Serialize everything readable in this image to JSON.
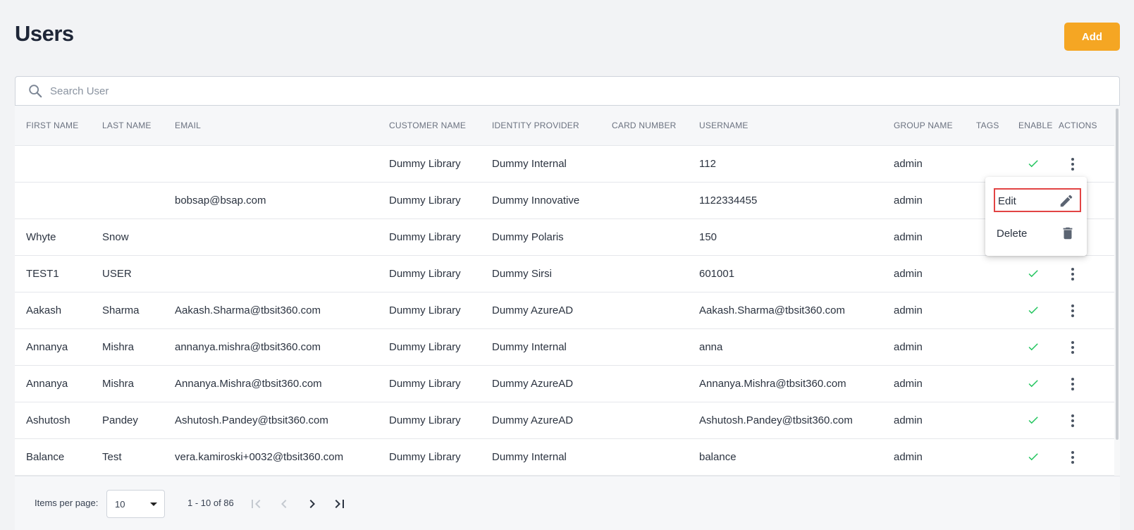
{
  "header": {
    "title": "Users",
    "add_label": "Add"
  },
  "search": {
    "placeholder": "Search User"
  },
  "table": {
    "columns": [
      "FIRST NAME",
      "LAST NAME",
      "EMAIL",
      "CUSTOMER NAME",
      "IDENTITY PROVIDER",
      "CARD NUMBER",
      "USERNAME",
      "GROUP NAME",
      "TAGS",
      "ENABLE",
      "ACTIONS"
    ],
    "rows": [
      {
        "first": "",
        "last": "",
        "email": "",
        "customer": "Dummy Library",
        "idp": "Dummy Internal",
        "card": "",
        "username": "112",
        "group": "admin",
        "tags": "",
        "enabled": true
      },
      {
        "first": "",
        "last": "",
        "email": "bobsap@bsap.com",
        "customer": "Dummy Library",
        "idp": "Dummy Innovative",
        "card": "",
        "username": "1122334455",
        "group": "admin",
        "tags": "",
        "enabled": true
      },
      {
        "first": "Whyte",
        "last": "Snow",
        "email": "",
        "customer": "Dummy Library",
        "idp": "Dummy Polaris",
        "card": "",
        "username": "150",
        "group": "admin",
        "tags": "",
        "enabled": true
      },
      {
        "first": "TEST1",
        "last": "USER",
        "email": "",
        "customer": "Dummy Library",
        "idp": "Dummy Sirsi",
        "card": "",
        "username": "601001",
        "group": "admin",
        "tags": "",
        "enabled": true
      },
      {
        "first": "Aakash",
        "last": "Sharma",
        "email": "Aakash.Sharma@tbsit360.com",
        "customer": "Dummy Library",
        "idp": "Dummy AzureAD",
        "card": "",
        "username": "Aakash.Sharma@tbsit360.com",
        "group": "admin",
        "tags": "",
        "enabled": true
      },
      {
        "first": "Annanya",
        "last": "Mishra",
        "email": "annanya.mishra@tbsit360.com",
        "customer": "Dummy Library",
        "idp": "Dummy Internal",
        "card": "",
        "username": "anna",
        "group": "admin",
        "tags": "",
        "enabled": true
      },
      {
        "first": "Annanya",
        "last": "Mishra",
        "email": "Annanya.Mishra@tbsit360.com",
        "customer": "Dummy Library",
        "idp": "Dummy AzureAD",
        "card": "",
        "username": "Annanya.Mishra@tbsit360.com",
        "group": "admin",
        "tags": "",
        "enabled": true
      },
      {
        "first": "Ashutosh",
        "last": "Pandey",
        "email": "Ashutosh.Pandey@tbsit360.com",
        "customer": "Dummy Library",
        "idp": "Dummy AzureAD",
        "card": "",
        "username": "Ashutosh.Pandey@tbsit360.com",
        "group": "admin",
        "tags": "",
        "enabled": true
      },
      {
        "first": "Balance",
        "last": "Test",
        "email": "vera.kamiroski+0032@tbsit360.com",
        "customer": "Dummy Library",
        "idp": "Dummy Internal",
        "card": "",
        "username": "balance",
        "group": "admin",
        "tags": "",
        "enabled": true
      }
    ]
  },
  "row_menu": {
    "open_on_row": 1,
    "items": [
      {
        "label": "Edit",
        "icon": "pencil-icon",
        "highlighted": true
      },
      {
        "label": "Delete",
        "icon": "trash-icon",
        "highlighted": false
      }
    ]
  },
  "pagination": {
    "items_per_page_label": "Items per page:",
    "items_per_page": "10",
    "range": "1 - 10 of 86"
  },
  "colors": {
    "accent": "#f5a623",
    "check": "#22c55e",
    "highlight_border": "#e24444",
    "title": "#1e2637"
  }
}
